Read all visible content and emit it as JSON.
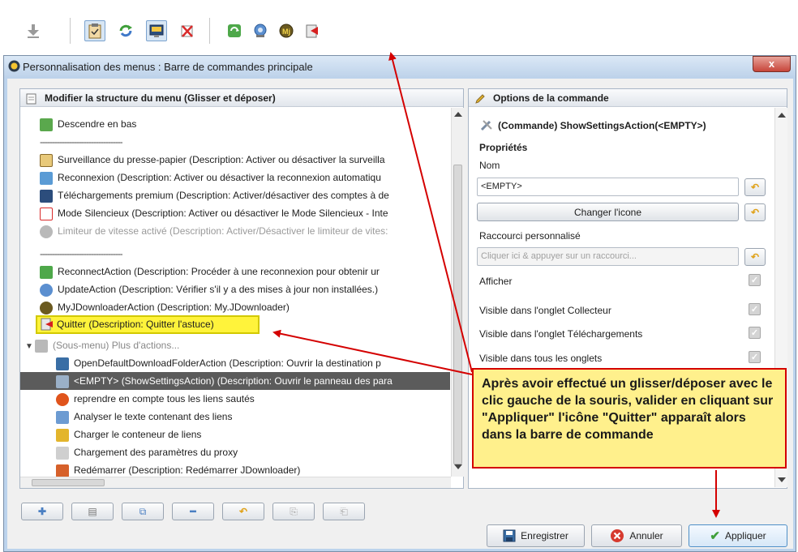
{
  "toolbar": {
    "icons": [
      "download-bottom-icon",
      "clipboard-icon",
      "reconnect-icon",
      "premium-icon",
      "silent-mode-icon",
      "reconnect-action-icon",
      "update-icon",
      "myjd-icon",
      "quit-icon"
    ]
  },
  "window": {
    "title": "Personnalisation des menus : Barre de commandes principale",
    "close_label": "x"
  },
  "left_panel": {
    "header": "Modifier la structure du menu (Glisser et déposer)",
    "rows": [
      {
        "label": "Descendre en bas"
      },
      {
        "label": "----------------------------------"
      },
      {
        "label": "Surveillance du presse-papier (Description: Activer ou désactiver la surveilla"
      },
      {
        "label": "Reconnexion (Description: Activer ou désactiver la reconnexion automatiqu"
      },
      {
        "label": "Téléchargements premium (Description: Activer/désactiver des comptes à de"
      },
      {
        "label": "Mode Silencieux (Description: Activer ou désactiver le Mode Silencieux - Inte"
      },
      {
        "label": "Limiteur de vitesse activé (Description: Activer/Désactiver le limiteur de vites:"
      },
      {
        "label": "----------------------------------"
      },
      {
        "label": "ReconnectAction (Description: Procéder à une reconnexion pour obtenir ur"
      },
      {
        "label": "UpdateAction (Description: Vérifier s'il y a des mises à jour non installées.)"
      },
      {
        "label": "MyJDownloaderAction (Description: My.JDownloader)"
      },
      {
        "label": "Quitter (Description: Quitter l'astuce)"
      },
      {
        "label": "(Sous-menu) Plus d'actions..."
      },
      {
        "label": "OpenDefaultDownloadFolderAction (Description: Ouvrir la destination p"
      },
      {
        "label": "<EMPTY> (ShowSettingsAction) (Description: Ouvrir le panneau des para"
      },
      {
        "label": "reprendre en compte tous les liens sautés"
      },
      {
        "label": "Analyser le texte contenant des liens"
      },
      {
        "label": "Charger le conteneur de liens"
      },
      {
        "label": "Chargement des paramètres du proxy"
      },
      {
        "label": "Redémarrer (Description: Redémarrer JDownloader)"
      }
    ]
  },
  "right_panel": {
    "header": "Options de la commande",
    "command_title": "(Commande) ShowSettingsAction(<EMPTY>)",
    "properties_heading": "Propriétés",
    "name_label": "Nom",
    "name_value": "<EMPTY>",
    "change_icon_button": "Changer l'icone",
    "shortcut_label": "Raccourci personnalisé",
    "shortcut_placeholder": "Cliquer ici & appuyer sur un raccourci...",
    "options": [
      {
        "label": "Afficher",
        "checked": true
      },
      {
        "label": "Visible dans l'onglet Collecteur",
        "checked": true
      },
      {
        "label": "Visible dans l'onglet Téléchargements",
        "checked": true
      },
      {
        "label": "Visible dans tous les onglets",
        "checked": true
      }
    ]
  },
  "bottom_buttons": {
    "save": "Enregistrer",
    "cancel": "Annuler",
    "apply": "Appliquer"
  },
  "callout": {
    "text": "Après avoir effectué un glisser/déposer avec le clic gauche de la souris, valider en cliquant sur \"Appliquer\" l'icône \"Quitter\" apparaît alors dans la barre de commande"
  },
  "colors": {
    "annotation_red": "#d40000",
    "callout_bg": "#fff08c",
    "highlight": "#fff33b",
    "selected_row": "#5b5b5b"
  }
}
